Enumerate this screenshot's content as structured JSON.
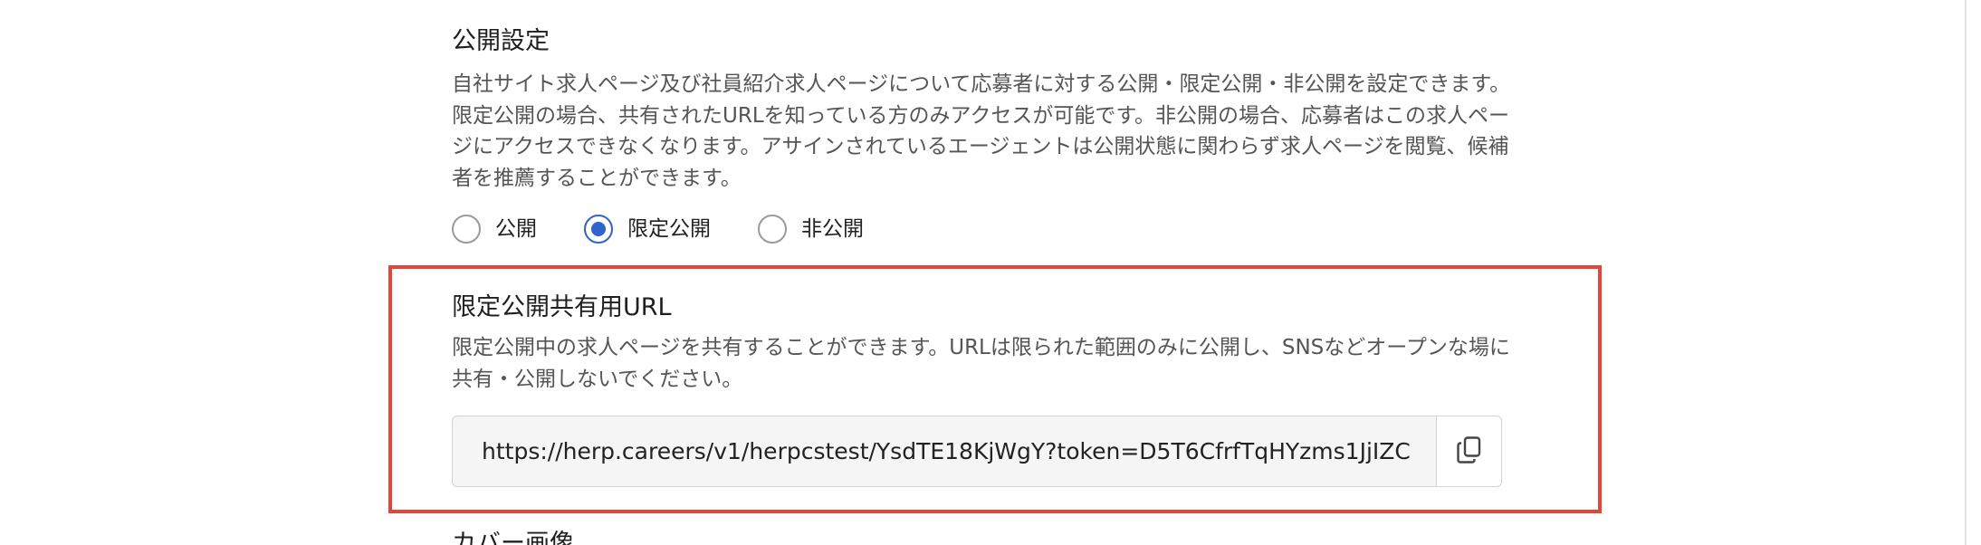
{
  "visibility": {
    "title": "公開設定",
    "description": "自社サイト求人ページ及び社員紹介求人ページについて応募者に対する公開・限定公開・非公開を設定できます。限定公開の場合、共有されたURLを知っている方のみアクセスが可能です。非公開の場合、応募者はこの求人ページにアクセスできなくなります。アサインされているエージェントは公開状態に関わらず求人ページを閲覧、候補者を推薦することができます。",
    "options": [
      {
        "label": "公開",
        "selected": false
      },
      {
        "label": "限定公開",
        "selected": true
      },
      {
        "label": "非公開",
        "selected": false
      }
    ]
  },
  "share_url": {
    "title": "限定公開共有用URL",
    "description": "限定公開中の求人ページを共有することができます。URLは限られた範囲のみに公開し、SNSなどオープンな場に共有・公開しないでください。",
    "url_value": "https://herp.careers/v1/herpcstest/YsdTE18KjWgY?token=D5T6CfrfTqHYzms1JjIZC",
    "copy_icon": "copy-icon"
  },
  "next_section": {
    "title": "カバー画像"
  },
  "colors": {
    "accent": "#2f63cf",
    "highlight_border": "#e2463a",
    "field_background": "#f5f5f5",
    "muted_text": "#555555"
  }
}
